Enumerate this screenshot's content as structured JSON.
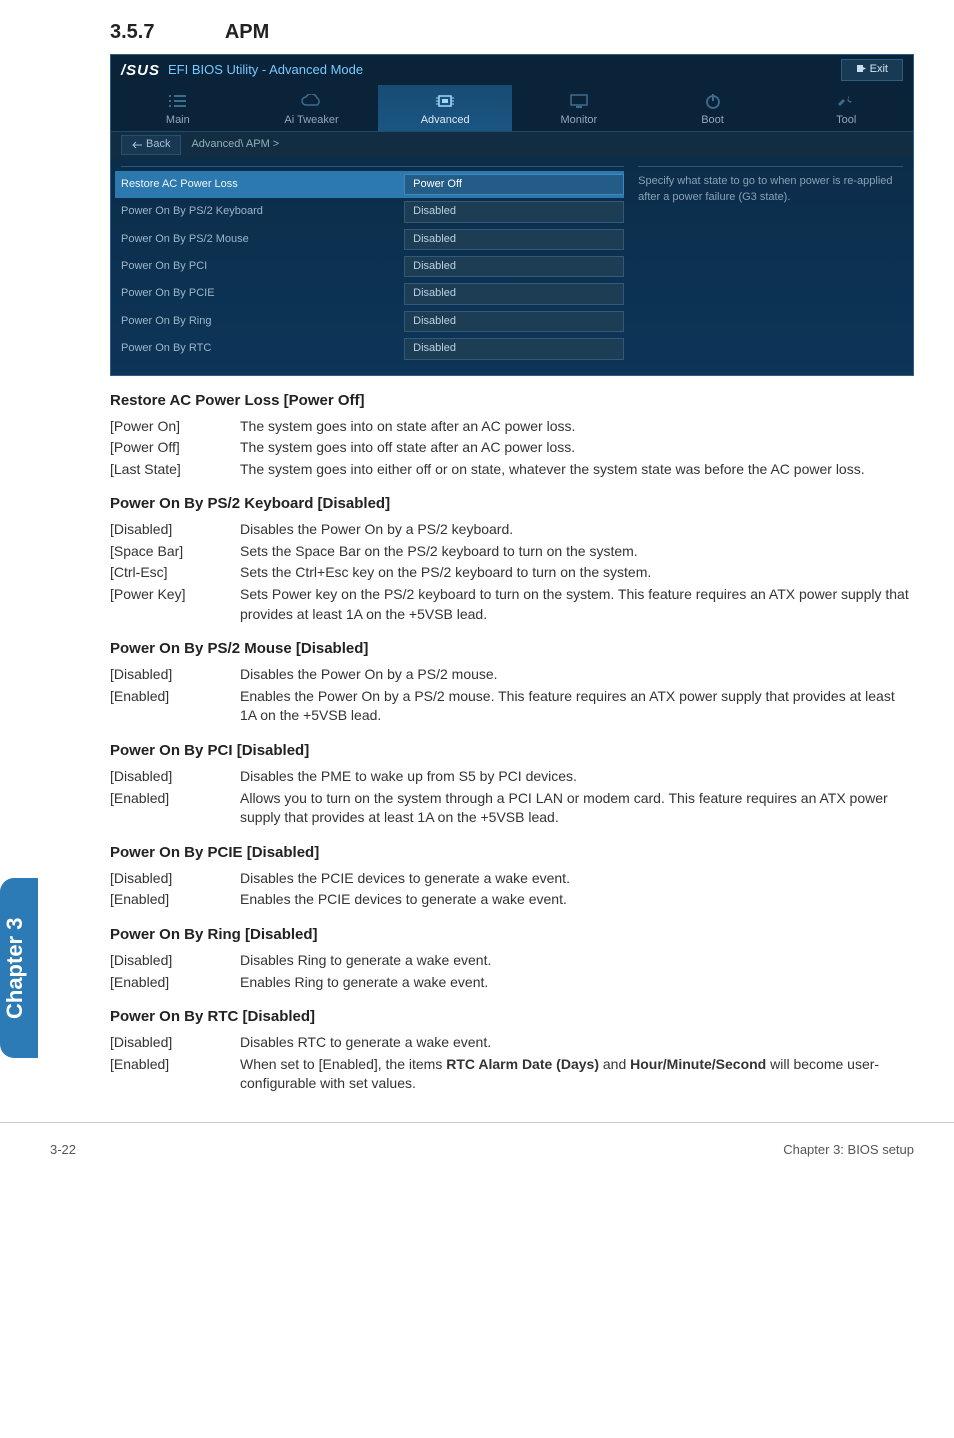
{
  "section_heading_number": "3.5.7",
  "section_heading_title": "APM",
  "bios": {
    "logo_text": "/SUS",
    "title": "EFI BIOS Utility - Advanced Mode",
    "exit_label": "Exit",
    "tabs": [
      {
        "name": "Main"
      },
      {
        "name": "Ai Tweaker"
      },
      {
        "name": "Advanced"
      },
      {
        "name": "Monitor"
      },
      {
        "name": "Boot"
      },
      {
        "name": "Tool"
      }
    ],
    "back_label": "Back",
    "breadcrumb": "Advanced\\ APM >",
    "settings": [
      {
        "label": "Restore AC Power Loss",
        "value": "Power Off",
        "selected": true
      },
      {
        "label": "Power On By PS/2 Keyboard",
        "value": "Disabled"
      },
      {
        "label": "Power On By PS/2 Mouse",
        "value": "Disabled"
      },
      {
        "label": "Power On By PCI",
        "value": "Disabled"
      },
      {
        "label": "Power On By PCIE",
        "value": "Disabled"
      },
      {
        "label": "Power On By Ring",
        "value": "Disabled"
      },
      {
        "label": "Power On By RTC",
        "value": "Disabled"
      }
    ],
    "help_text": "Specify what state to go to when power is re-applied after a power failure (G3 state)."
  },
  "sections": {
    "restore_ac": {
      "title": "Restore AC Power Loss [Power Off]",
      "opts": [
        {
          "k": "[Power On]",
          "v": "The system goes into on state after an AC power loss."
        },
        {
          "k": "[Power Off]",
          "v": "The system goes into off state after an AC power loss."
        },
        {
          "k": "[Last State]",
          "v": "The system goes into either off or on state, whatever the system state was before the AC power loss."
        }
      ]
    },
    "ps2_kb": {
      "title": "Power On By PS/2 Keyboard [Disabled]",
      "opts": [
        {
          "k": "[Disabled]",
          "v": "Disables the Power On by a PS/2 keyboard."
        },
        {
          "k": "[Space Bar]",
          "v": "Sets the Space Bar on the PS/2 keyboard to turn on the system."
        },
        {
          "k": "[Ctrl-Esc]",
          "v": "Sets the Ctrl+Esc key on the PS/2 keyboard to turn on the system."
        },
        {
          "k": "[Power Key]",
          "v": "Sets Power key on the PS/2 keyboard to turn on the system. This feature requires an ATX power supply that provides at least 1A on the +5VSB lead."
        }
      ]
    },
    "ps2_mouse": {
      "title": "Power On By PS/2 Mouse [Disabled]",
      "opts": [
        {
          "k": "[Disabled]",
          "v": "Disables the Power On by a PS/2 mouse."
        },
        {
          "k": "[Enabled]",
          "v": "Enables the Power On by a PS/2 mouse. This feature requires an ATX power supply that provides at least 1A on the +5VSB lead."
        }
      ]
    },
    "pci": {
      "title": "Power On By PCI [Disabled]",
      "opts": [
        {
          "k": "[Disabled]",
          "v": "Disables the PME to wake up from S5 by PCI devices."
        },
        {
          "k": "[Enabled]",
          "v": "Allows you to turn on the system through a PCI LAN or modem card. This feature requires an ATX power supply that provides at least 1A on the +5VSB lead."
        }
      ]
    },
    "pcie": {
      "title": "Power On By PCIE [Disabled]",
      "opts": [
        {
          "k": "[Disabled]",
          "v": "Disables the PCIE devices to generate a wake event."
        },
        {
          "k": "[Enabled]",
          "v": "Enables the PCIE devices to generate a wake event."
        }
      ]
    },
    "ring": {
      "title": "Power On By Ring [Disabled]",
      "opts": [
        {
          "k": "[Disabled]",
          "v": "Disables Ring to generate a wake event."
        },
        {
          "k": "[Enabled]",
          "v": "Enables Ring to generate a wake event."
        }
      ]
    },
    "rtc": {
      "title": "Power On By RTC [Disabled]",
      "opts": [
        {
          "k": "[Disabled]",
          "v": "Disables RTC to generate a wake event."
        }
      ],
      "enabled_key": "[Enabled]",
      "enabled_pre": "When set to [Enabled], the items ",
      "enabled_b1": "RTC Alarm Date (Days)",
      "enabled_mid": " and ",
      "enabled_b2": "Hour/Minute/Second",
      "enabled_post": " will become user-configurable with set values."
    }
  },
  "side_tab": "Chapter 3",
  "footer_left": "3-22",
  "footer_right": "Chapter 3: BIOS setup"
}
